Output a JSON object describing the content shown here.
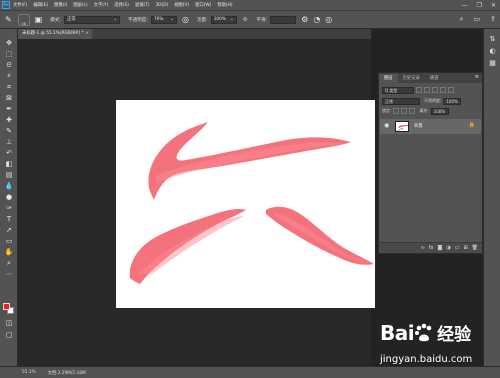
{
  "app": {
    "logo": "Ps"
  },
  "menubar": {
    "items": [
      "文件(F)",
      "编辑(E)",
      "图像(I)",
      "图层(L)",
      "文字(Y)",
      "选择(S)",
      "滤镜(T)",
      "3D(D)",
      "视图(V)",
      "窗口(W)",
      "帮助(H)"
    ],
    "window_controls": [
      "—",
      "❐",
      "✕"
    ]
  },
  "options_bar": {
    "brush_size": "38",
    "mode_label": "模式:",
    "mode_value": "正常",
    "opacity_label": "不透明度:",
    "opacity_value": "70%",
    "flow_label": "流量:",
    "flow_value": "100%",
    "smoothing_label": "平滑:",
    "smoothing_value": ""
  },
  "document": {
    "tab_title": "未标题-1 @ 55.1%(RGB/8#) *",
    "close_glyph": "×",
    "canvas_color": "#ffffff",
    "stroke_color": "#f25a66"
  },
  "toolbar": {
    "tools": [
      "move-tool",
      "marquee-tool",
      "lasso-tool",
      "magic-wand-tool",
      "crop-tool",
      "frame-tool",
      "eyedropper-tool",
      "healing-tool",
      "brush-tool",
      "stamp-tool",
      "history-brush-tool",
      "eraser-tool",
      "gradient-tool",
      "blur-tool",
      "dodge-tool",
      "pen-tool",
      "type-tool",
      "path-select-tool",
      "shape-tool",
      "hand-tool",
      "zoom-tool",
      "more-tools"
    ],
    "foreground_color": "#ff1b1b",
    "background_color": "#ffffff"
  },
  "layers_panel": {
    "tabs": [
      "图层",
      "历史记录",
      "通道"
    ],
    "filter_label": "Q 类型",
    "blend_mode": "正常",
    "opacity_label": "不透明度:",
    "opacity_value": "100%",
    "lock_label": "锁定:",
    "fill_label": "填充:",
    "fill_value": "100%",
    "layers": [
      {
        "name": "背景",
        "visible": true,
        "locked": true
      }
    ]
  },
  "status_bar": {
    "zoom": "55.1%",
    "doc_info": "文档:2.29M/2.18M"
  },
  "watermark": {
    "brand": "Bai",
    "brand_suffix": "经验",
    "url": "jingyan.baidu.com"
  }
}
